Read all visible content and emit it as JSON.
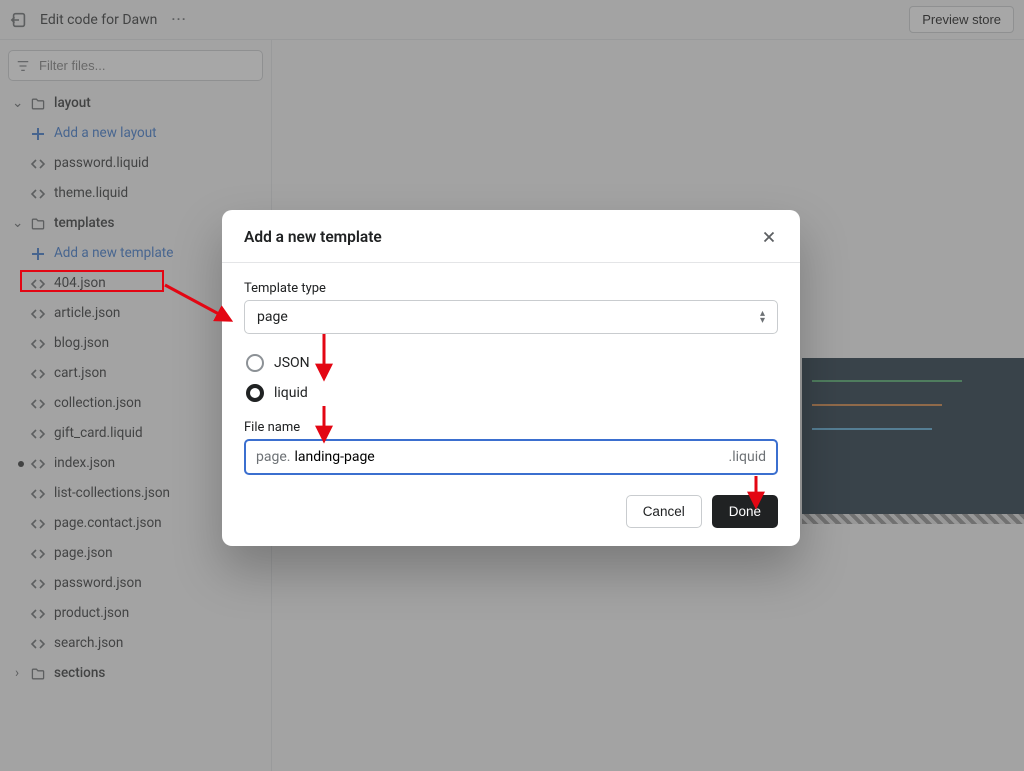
{
  "topbar": {
    "title": "Edit code for Dawn",
    "preview_label": "Preview store"
  },
  "sidebar": {
    "filter_placeholder": "Filter files...",
    "folders": {
      "layout": {
        "label": "layout",
        "add_label": "Add a new layout",
        "files": [
          "password.liquid",
          "theme.liquid"
        ]
      },
      "templates": {
        "label": "templates",
        "add_label": "Add a new template",
        "files": [
          "404.json",
          "article.json",
          "blog.json",
          "cart.json",
          "collection.json",
          "gift_card.liquid",
          "index.json",
          "list-collections.json",
          "page.contact.json",
          "page.json",
          "password.json",
          "product.json",
          "search.json"
        ],
        "modified_file": "index.json"
      },
      "sections": {
        "label": "sections"
      }
    }
  },
  "modal": {
    "title": "Add a new template",
    "type_label": "Template type",
    "type_value": "page",
    "radio_json": "JSON",
    "radio_liquid": "liquid",
    "filename_label": "File name",
    "filename_prefix": "page.",
    "filename_value": "landing-page",
    "filename_suffix": ".liquid",
    "cancel": "Cancel",
    "done": "Done"
  }
}
